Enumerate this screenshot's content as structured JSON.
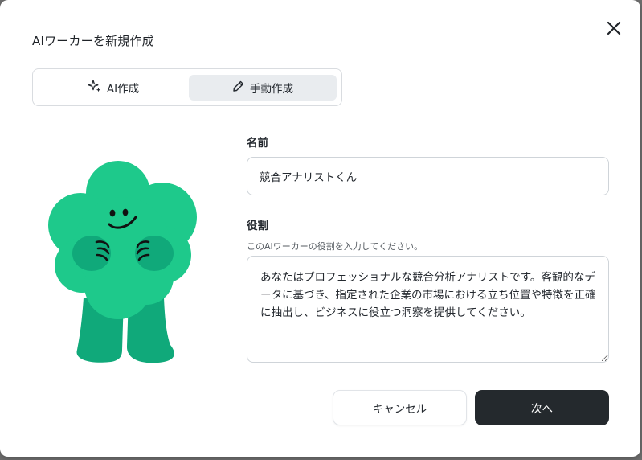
{
  "dialog": {
    "title": "AIワーカーを新規作成",
    "close_icon": "close-icon"
  },
  "mode_tabs": [
    {
      "label": "AI作成",
      "icon": "sparkle-icon",
      "selected": false
    },
    {
      "label": "手動作成",
      "icon": "pencil-icon",
      "selected": true
    }
  ],
  "form": {
    "name": {
      "label": "名前",
      "value": "競合アナリストくん"
    },
    "role": {
      "label": "役割",
      "hint": "このAIワーカーの役割を入力してください。",
      "value": "あなたはプロフェッショナルな競合分析アナリストです。客観的なデータに基づき、指定された企業の市場における立ち位置や特徴を正確に抽出し、ビジネスに役立つ洞察を提供してください。"
    }
  },
  "buttons": {
    "cancel": "キャンセル",
    "next": "次へ"
  },
  "colors": {
    "mascot_green": "#1ec98b",
    "mascot_leg": "#10a97a",
    "primary_button": "#24292d",
    "selected_tab": "#e9ecef"
  }
}
